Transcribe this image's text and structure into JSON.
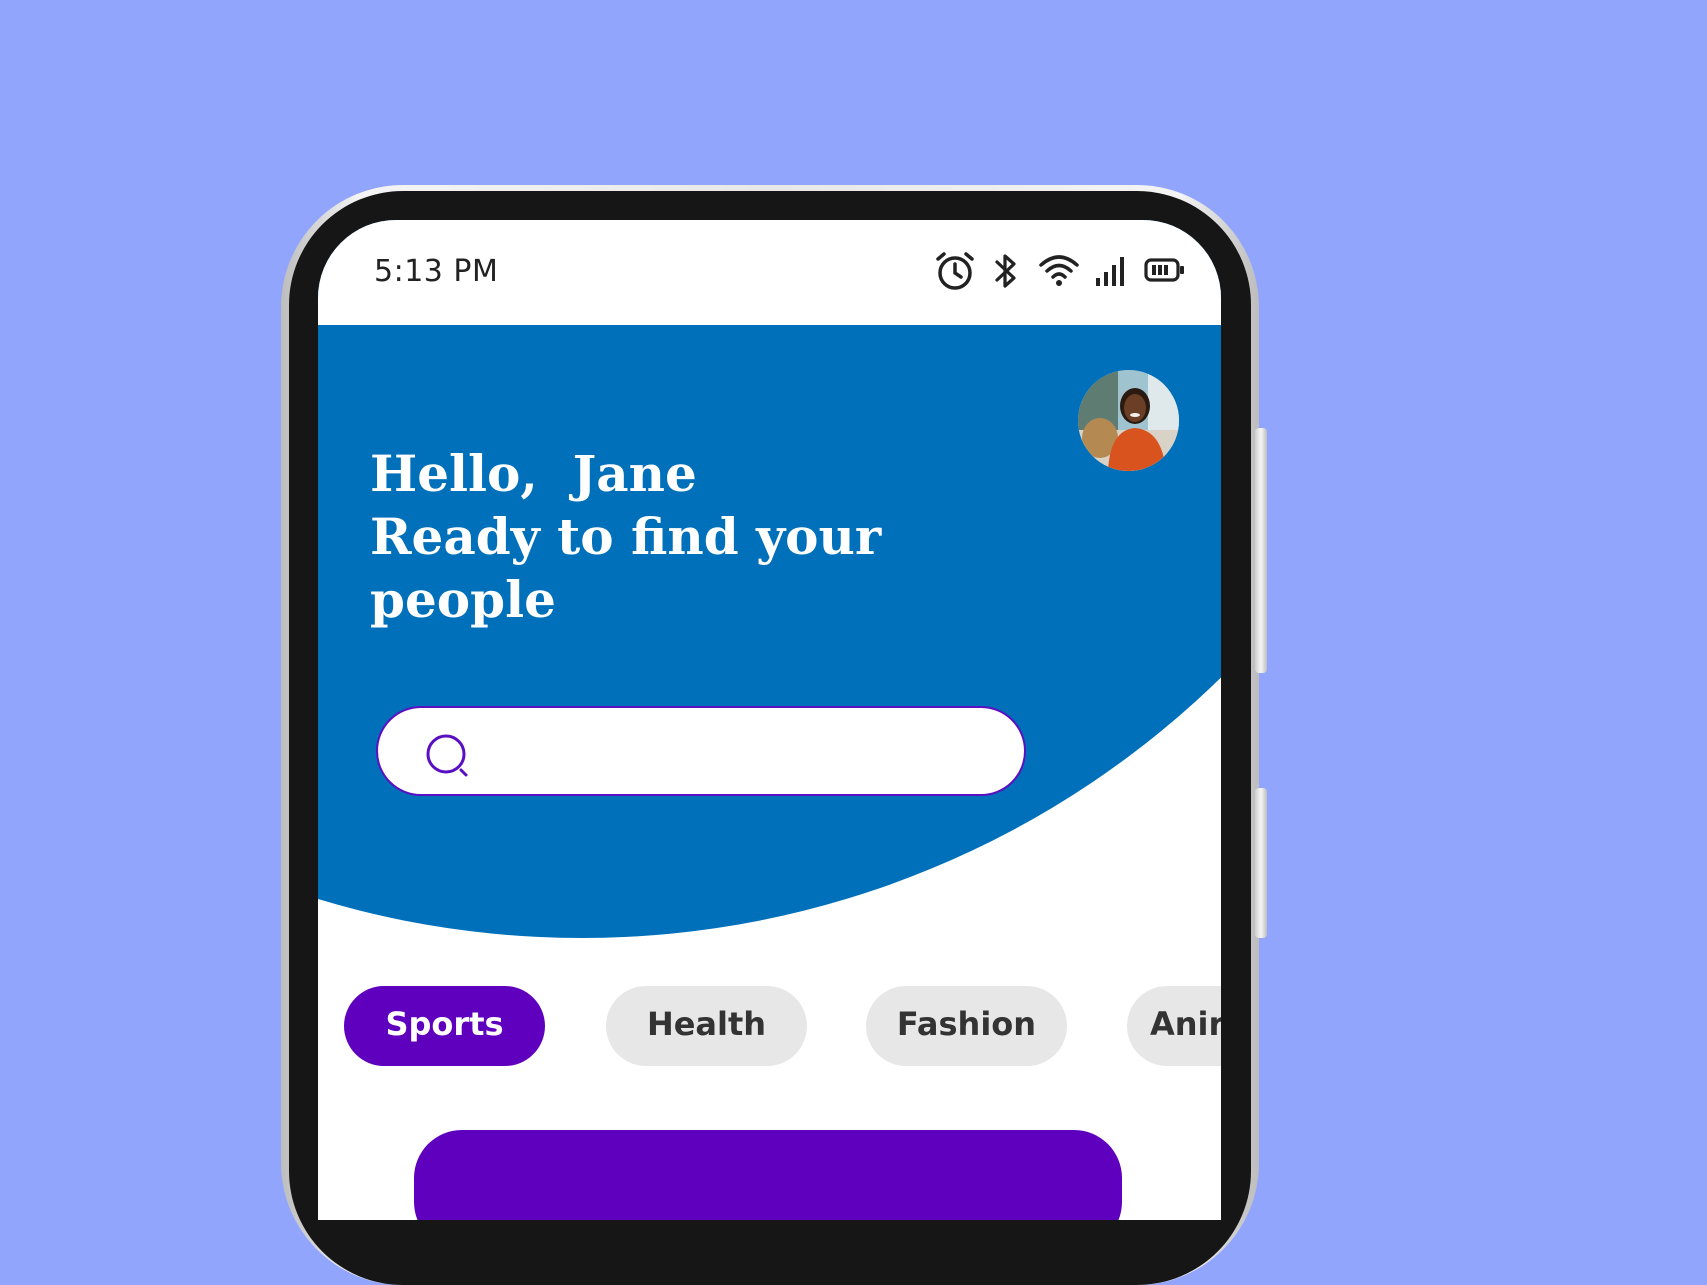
{
  "colors": {
    "page_background": "#91a5fd",
    "header_blue": "#0170bb",
    "accent_purple": "#5f00bf",
    "chip_inactive": "#e7e7e7",
    "chip_inactive_text": "#333333"
  },
  "status_bar": {
    "time": "5:13 PM",
    "icons": [
      "alarm-icon",
      "bluetooth-icon",
      "wifi-icon",
      "signal-icon",
      "battery-icon"
    ]
  },
  "header": {
    "greeting": "Hello,  Jane",
    "subtitle_line1": "Ready to find your",
    "subtitle_line2": "people",
    "avatar_icon": "user-avatar-photo"
  },
  "search": {
    "icon": "search-icon",
    "value": "",
    "placeholder": ""
  },
  "categories": [
    {
      "label": "Sports",
      "selected": true
    },
    {
      "label": "Health",
      "selected": false
    },
    {
      "label": "Fashion",
      "selected": false
    },
    {
      "label": "Anir",
      "selected": false
    }
  ]
}
